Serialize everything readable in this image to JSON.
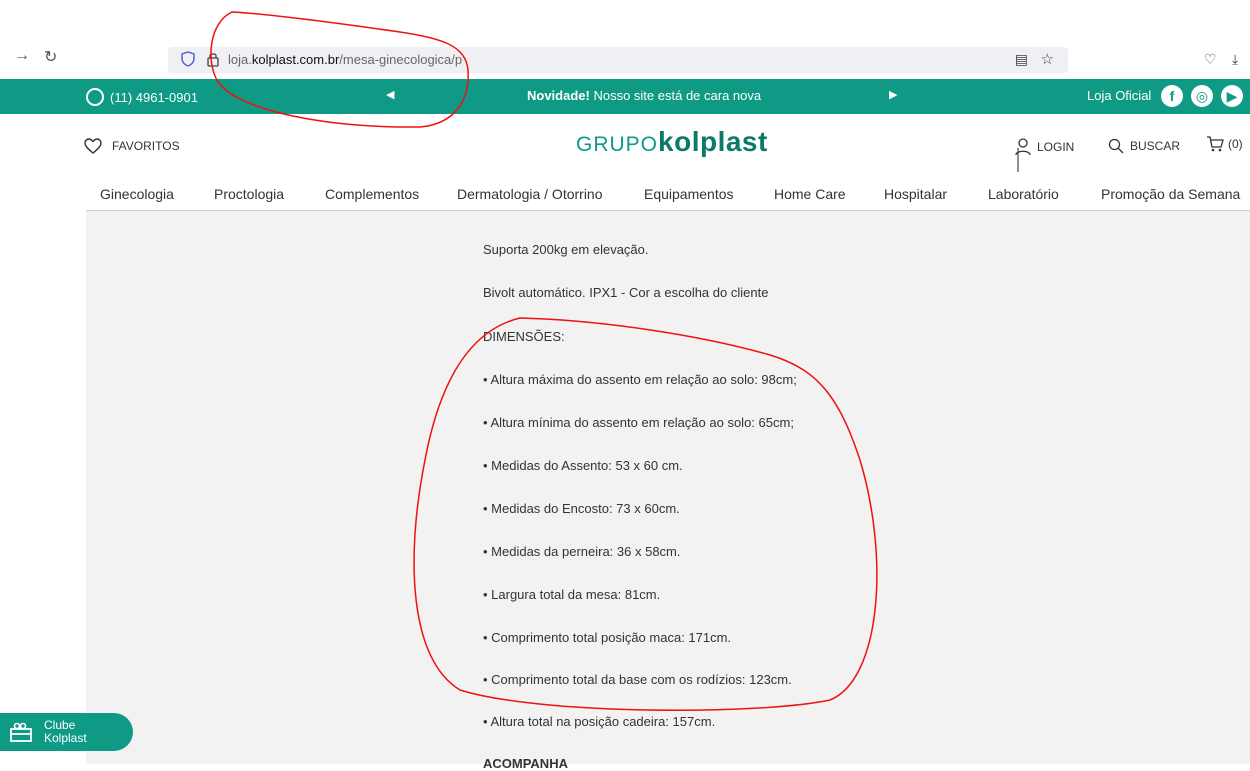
{
  "browser": {
    "url_prefix": "loja.",
    "url_domain": "kolplast.com.br",
    "url_path": "/mesa-ginecologica/p"
  },
  "promo": {
    "phone": "(11) 4961-0901",
    "news_bold": "Novidade!",
    "news_text": " Nosso site está de cara nova",
    "oficial": "Loja Oficial"
  },
  "header": {
    "favoritos": "FAVORITOS",
    "logo_grupo": "GRUPO",
    "logo_brand": "kolplast",
    "login": "LOGIN",
    "buscar": "BUSCAR",
    "cart_count": "(0)"
  },
  "nav": {
    "items": [
      "Ginecologia",
      "Proctologia",
      "Complementos",
      "Dermatologia / Otorrino",
      "Equipamentos",
      "Home Care",
      "Hospitalar",
      "Laboratório",
      "Promoção da Semana"
    ]
  },
  "content": {
    "lines": [
      "Suporta 200kg em elevação.",
      "Bivolt automático. IPX1 - Cor a escolha do cliente",
      "DIMENSÕES:",
      "• Altura máxima do assento em relação ao solo: 98cm;",
      "• Altura mínima do assento em relação ao solo: 65cm;",
      "• Medidas do Assento: 53 x 60 cm.",
      "• Medidas do Encosto: 73 x 60cm.",
      "• Medidas da perneira: 36 x 58cm.",
      "• Largura total da mesa: 81cm.",
      "• Comprimento total posição maca: 171cm.",
      "• Comprimento total da base com os rodízios: 123cm.",
      "• Altura total na posição cadeira: 157cm."
    ],
    "section_heading": "ACOMPANHA"
  },
  "clube": {
    "line1": "Clube",
    "line2": "Kolplast"
  },
  "colors": {
    "brand_green": "#0e9a84",
    "annotation_red": "#e11"
  }
}
